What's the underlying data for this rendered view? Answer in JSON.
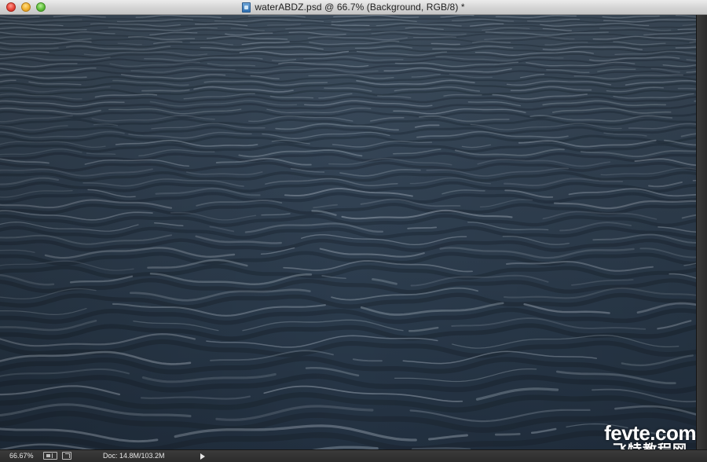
{
  "window": {
    "title": "waterABDZ.psd @ 66.7% (Background, RGB/8) *",
    "document_icon": "psd-document-icon",
    "controls": [
      "close-button",
      "minimize-button",
      "zoom-button"
    ]
  },
  "canvas": {
    "content": "water-surface-photo",
    "colors": {
      "deep": "#1f2b38",
      "mid": "#37485a",
      "highlight": "#8b98a5"
    }
  },
  "watermark": {
    "line1": "fevte.com",
    "line2": "飞特教程网"
  },
  "statusbar": {
    "zoom": "66.67%",
    "doc_info": "Doc: 14.8M/103.2M",
    "icons": [
      "proof-setup-icon",
      "share-icon",
      "menu-arrow-icon"
    ]
  }
}
